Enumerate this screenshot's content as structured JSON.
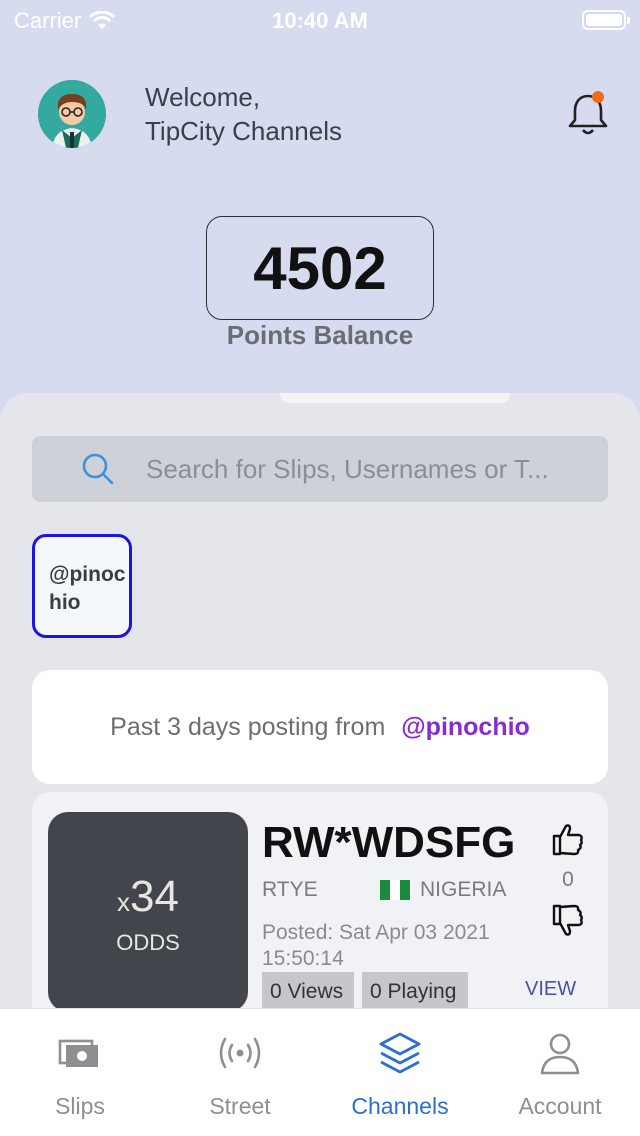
{
  "status_bar": {
    "carrier": "Carrier",
    "time": "10:40 AM"
  },
  "header": {
    "welcome_line1": "Welcome,",
    "welcome_line2": "TipCity Channels"
  },
  "points": {
    "value": "4502",
    "label": "Points Balance"
  },
  "search": {
    "placeholder": "Search for Slips, Usernames or T..."
  },
  "channel_chip": {
    "label": "@pinochio"
  },
  "posting": {
    "text": "Past 3 days posting from",
    "user": "@pinochio"
  },
  "slip": {
    "odds_prefix": "x",
    "odds_value": "34",
    "odds_label": "ODDS",
    "code": "RW*WDSFG",
    "user": "RTYE",
    "country": "NIGERIA",
    "posted": "Posted: Sat Apr 03 2021 15:50:14",
    "likes": "0",
    "views": "0 Views",
    "playing": "0 Playing",
    "view_label": "VIEW"
  },
  "tabs": [
    {
      "label": "Slips",
      "icon": "money-icon"
    },
    {
      "label": "Street",
      "icon": "broadcast-icon"
    },
    {
      "label": "Channels",
      "icon": "layers-icon",
      "active": true
    },
    {
      "label": "Account",
      "icon": "person-icon"
    }
  ],
  "colors": {
    "accent": "#2a6fd6",
    "chip_border": "#1a14e6",
    "username": "#8a2bd1",
    "notification": "#f26a1b"
  }
}
